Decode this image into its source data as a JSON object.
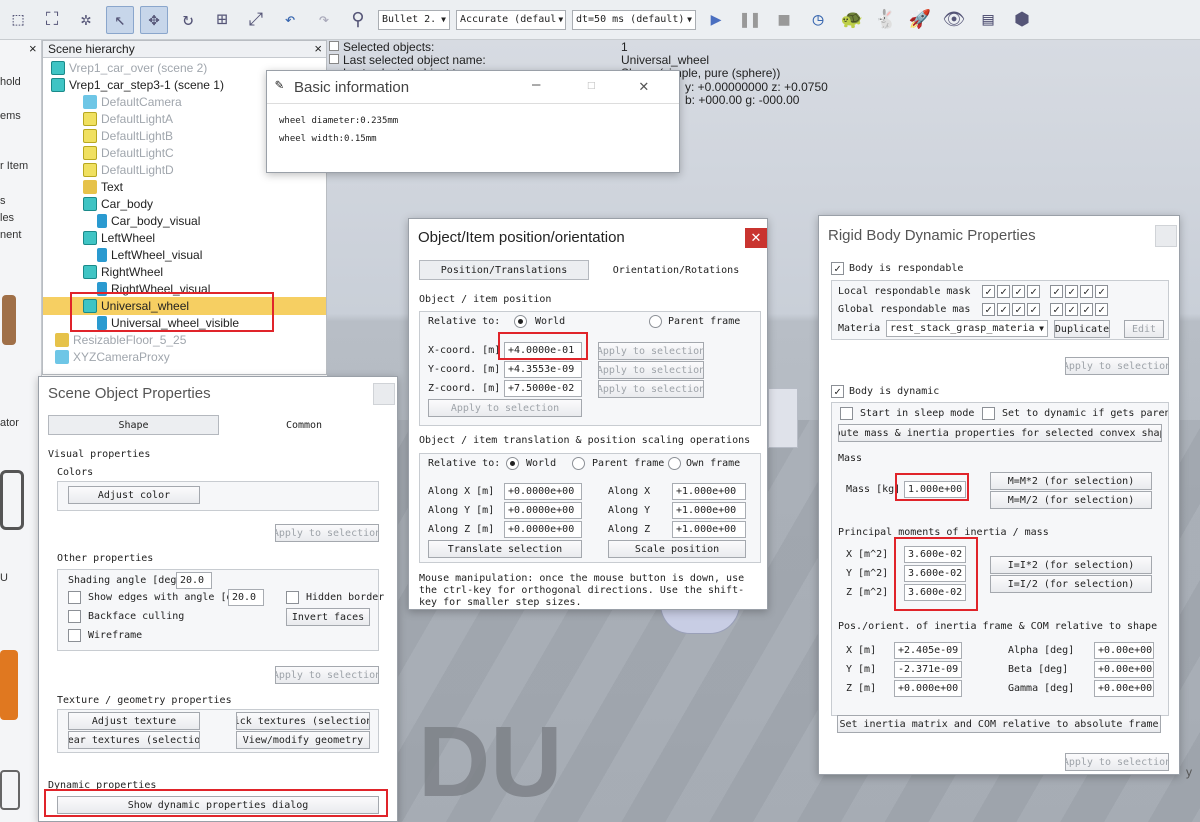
{
  "toolbar": {
    "engine": "Bullet 2.",
    "accuracy": "Accurate (defaul",
    "timestep": "dt=50 ms (default)"
  },
  "left_strip": [
    "hold",
    "ems",
    "r Item",
    "s",
    "les",
    "nent",
    "ator",
    "U"
  ],
  "hierarchy": {
    "tab_label": "Scene hierarchy",
    "items": [
      {
        "label": "Vrep1_car_over (scene 2)",
        "icon": "scene-icon",
        "dim": true
      },
      {
        "label": "Vrep1_car_step3-1 (scene 1)",
        "icon": "scene-icon",
        "dim": false
      },
      {
        "label": "DefaultCamera",
        "icon": "camera-icon",
        "dim": true
      },
      {
        "label": "DefaultLightA",
        "icon": "light-icon",
        "dim": true
      },
      {
        "label": "DefaultLightB",
        "icon": "light-icon",
        "dim": true
      },
      {
        "label": "DefaultLightC",
        "icon": "light-icon",
        "dim": true
      },
      {
        "label": "DefaultLightD",
        "icon": "light-icon",
        "dim": true
      },
      {
        "label": "Text",
        "icon": "text-icon",
        "dim": false
      },
      {
        "label": "Car_body",
        "icon": "cube-icon",
        "dim": false
      },
      {
        "label": "Car_body_visual",
        "icon": "shape-icon",
        "dim": false
      },
      {
        "label": "LeftWheel",
        "icon": "cube-icon",
        "dim": false
      },
      {
        "label": "LeftWheel_visual",
        "icon": "shape-icon",
        "dim": false
      },
      {
        "label": "RightWheel",
        "icon": "cube-icon",
        "dim": false
      },
      {
        "label": "RightWheel_visual",
        "icon": "shape-icon",
        "dim": false
      },
      {
        "label": "Universal_wheel",
        "icon": "cube-icon",
        "dim": false
      },
      {
        "label": "Universal_wheel_visible",
        "icon": "shape-icon",
        "dim": false
      },
      {
        "label": "ResizableFloor_5_25",
        "icon": "floor-icon",
        "dim": true
      },
      {
        "label": "XYZCameraProxy",
        "icon": "camera-icon",
        "dim": true
      }
    ]
  },
  "selection_info": {
    "line1_label": "Selected objects:",
    "line1_value": "1",
    "line2_label": "Last selected object name:",
    "line2_value": "Universal_wheel",
    "line3_label": "Last selected object type:",
    "line3_value": "Shape (simple, pure (sphere))",
    "line4": "y: +0.00000000   z: +0.0750",
    "line5": "b: +000.00   g: -000.00"
  },
  "basic_info": {
    "title": "Basic information",
    "line1": "wheel diameter:0.235mm",
    "line2": "wheel width:0.15mm"
  },
  "pos_dialog": {
    "title": "Object/Item position/orientation",
    "tab1": "Position/Translations",
    "tab2": "Orientation/Rotations",
    "sec1": "Object / item position",
    "relative_to": "Relative to:",
    "world": "World",
    "parent_frame": "Parent frame",
    "x_label": "X-coord. [m]",
    "x_value": "+4.0000e-01",
    "y_label": "Y-coord. [m]",
    "y_value": "+4.3553e-09",
    "z_label": "Z-coord. [m]",
    "z_value": "+7.5000e-02",
    "apply_sel": "Apply to selection",
    "sec2": "Object / item translation & position scaling operations",
    "own_frame": "Own frame",
    "along_x": "Along X [m]",
    "along_y": "Along Y [m]",
    "along_z": "Along Z [m]",
    "ax": "+0.0000e+00",
    "ay": "+0.0000e+00",
    "az": "+0.0000e+00",
    "sx_label": "Along X",
    "sy_label": "Along Y",
    "sz_label": "Along Z",
    "sx": "+1.000e+00",
    "sy": "+1.000e+00",
    "sz": "+1.000e+00",
    "translate_btn": "Translate selection",
    "scale_btn": "Scale position",
    "note": "Mouse manipulation: once the mouse button is down, use the ctrl-key for orthogonal directions. Use the shift-key for smaller step sizes."
  },
  "scene_props": {
    "title": "Scene Object Properties",
    "tab1": "Shape",
    "tab2": "Common",
    "visual": "Visual properties",
    "colors": "Colors",
    "adjust_color": "Adjust color",
    "apply_sel": "Apply to selection",
    "other": "Other properties",
    "shading": "Shading angle [deg]",
    "shading_value": "20.0",
    "show_edges": "Show edges with angle [de",
    "edges_value": "20.0",
    "hidden_border": "Hidden border",
    "backface": "Backface culling",
    "invert": "Invert faces",
    "wireframe": "Wireframe",
    "texture": "Texture / geometry properties",
    "adjust_texture": "Adjust texture",
    "pick_textures": "ick textures (selection",
    "clear_textures": "lear textures (selection",
    "view_geom": "View/modify geometry",
    "dynamic": "Dynamic properties",
    "show_dyn": "Show dynamic properties dialog"
  },
  "rigid": {
    "title": "Rigid Body Dynamic Properties",
    "respondable": "Body is respondable",
    "local_mask": "Local respondable mask",
    "global_mask": "Global respondable mas",
    "material_label": "Materia",
    "material": "rest_stack_grasp_materia",
    "duplicate": "Duplicate",
    "edit": "Edit",
    "apply_sel": "Apply to selection",
    "dynamic": "Body is dynamic",
    "sleep": "Start in sleep mode",
    "set_dyn": "Set to dynamic if gets paren",
    "compute": "mpute mass & inertia properties for selected convex shape",
    "mass_sec": "Mass",
    "mass_label": "Mass [kg]",
    "mass_value": "1.000e+00",
    "mm2": "M=M*2  (for selection)",
    "md2": "M=M/2  (for selection)",
    "inertia_sec": "Principal moments of inertia / mass",
    "ix_label": "X [m^2]",
    "iy_label": "Y [m^2]",
    "iz_label": "Z [m^2]",
    "ix": "3.600e-02",
    "iy": "3.600e-02",
    "iz": "3.600e-02",
    "im2": "I=I*2  (for selection)",
    "id2": "I=I/2  (for selection)",
    "com_sec": "Pos./orient. of inertia frame & COM relative to shape fra",
    "cx_label": "X [m]",
    "cy_label": "Y [m]",
    "cz_label": "Z [m]",
    "cx": "+2.405e-09",
    "cy": "-2.371e-09",
    "cz": "+0.000e+00",
    "alpha_label": "Alpha [deg]",
    "beta_label": "Beta [deg]",
    "gamma_label": "Gamma [deg]",
    "alpha": "+0.00e+00",
    "beta": "+0.00e+00",
    "gamma": "+0.00e+00",
    "set_inertia": "Set inertia matrix and COM relative to absolute frame"
  },
  "watermark": "DU",
  "axis_y": "y"
}
